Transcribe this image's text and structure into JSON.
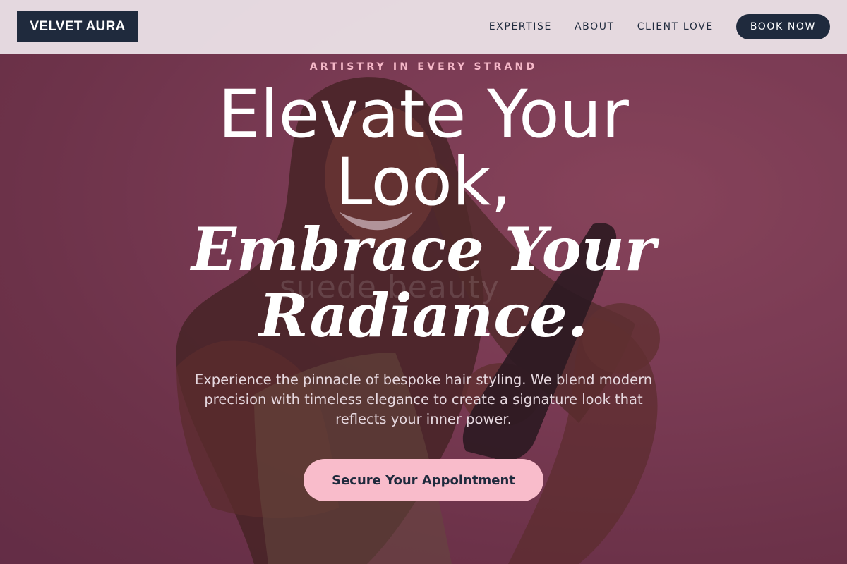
{
  "brand": {
    "name": "VELVET AURA"
  },
  "nav": {
    "links": [
      "EXPERTISE",
      "ABOUT",
      "CLIENT LOVE"
    ],
    "book_label": "BOOK NOW"
  },
  "hero": {
    "eyebrow": "ARTISTRY IN EVERY STRAND",
    "headline_lines": [
      "Elevate Your",
      "Look,"
    ],
    "subheadline_lines": [
      "Embrace Your",
      "Radiance."
    ],
    "description": "Experience the pinnacle of bespoke hair styling. We blend modern precision with timeless elegance to create a signature look that reflects your inner power.",
    "cta_label": "Secure Your Appointment",
    "watermark": "suede.beauty"
  },
  "colors": {
    "navy": "#1f2a3d",
    "accent_pink": "#f9bccb",
    "eyebrow_pink": "#f5b8c8",
    "background_berry": "#7a3d52",
    "nav_background": "#e8dee4"
  },
  "icons": {
    "hero_image": "woman-with-flat-iron-photo"
  }
}
